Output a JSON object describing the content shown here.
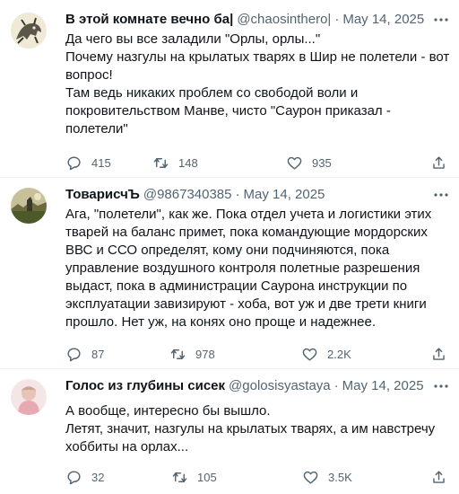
{
  "tweets": [
    {
      "name": "В этой комнате вечно ба|",
      "handle": "@chaosinthero|",
      "sep": "·",
      "date": "May 14, 2025",
      "lines": [
        "Да чего вы все заладили \"Орлы, орлы...\"",
        "Почему назгулы на крылатых тварях в Шир не полетели - вот вопрос!",
        "Там ведь никаких проблем со свободой воли и покровительством Манве, чисто \"Саурон приказал - полетели\""
      ],
      "replies": "415",
      "retweets": "148",
      "likes": "935"
    },
    {
      "name": "ТоварисчЪ",
      "handle": "@9867340385",
      "sep": "·",
      "date": "May 14, 2025",
      "lines": [
        "Ага, \"полетели\", как же. Пока отдел учета и логистики этих тварей на баланс примет, пока командующие мордорских ВВС и ССО определят, кому они подчиняются,  пока управление воздушного контроля полетные разрешения выдаст, пока в администрации Саурона инструкции по эксплуатации завизируют - хоба, вот уж и две трети книги прошло. Нет уж, на конях оно проще и надежнее."
      ],
      "replies": "87",
      "retweets": "978",
      "likes": "2.2K"
    },
    {
      "name": "Голос из глубины сисек",
      "handle": "@golosisyastaya",
      "sep": "·",
      "date": "May 14, 2025",
      "lines": [
        "А вообще, интересно бы вышло.",
        "Летят, значит, назгулы на крылатых тварях, а им навстречу хоббиты на орлах..."
      ],
      "replies": "32",
      "retweets": "105",
      "likes": "3.5K"
    }
  ],
  "icons": {
    "more": "more-dots-icon",
    "reply": "reply-bubble-icon",
    "retweet": "retweet-arrows-icon",
    "like": "heart-icon",
    "share": "share-upload-icon"
  },
  "colors": {
    "text": "#0f1419",
    "secondary": "#536471",
    "divider": "#eff3f4"
  }
}
